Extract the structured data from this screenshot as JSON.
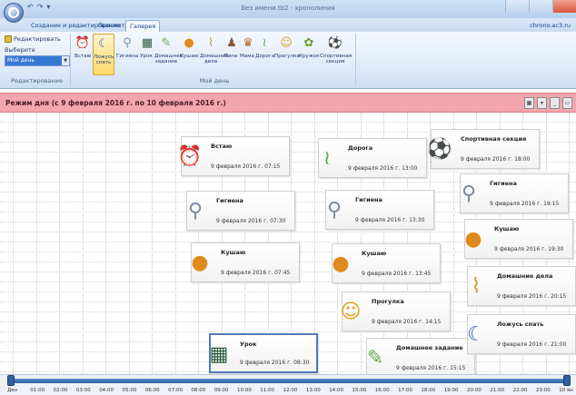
{
  "window": {
    "title": "Без имени.tb2 - хронолиния"
  },
  "tabs": [
    {
      "label": "Создание и редактирование"
    },
    {
      "label": "Просмотр"
    },
    {
      "label": "Галерея"
    }
  ],
  "brand": "chrono.ac3.ru",
  "ribbon": {
    "edit_label": "Редактировать",
    "collection_label": "Выберите коллекцию:",
    "collection_value": "Мой день",
    "edit_group_caption": "Редактирование",
    "day_group_caption": "Мой день",
    "day_items": [
      {
        "label": "Встаю",
        "icon": "alarm-clock-icon"
      },
      {
        "label": "Ложусь спать",
        "icon": "moon-icon"
      },
      {
        "label": "Гигиена",
        "icon": "faucet-icon"
      },
      {
        "label": "Урок",
        "icon": "blackboard-icon"
      },
      {
        "label": "Домашнее задание",
        "icon": "homework-icon"
      },
      {
        "label": "Кушаю",
        "icon": "food-icon"
      },
      {
        "label": "Домашние дела",
        "icon": "broom-icon"
      },
      {
        "label": "Папа",
        "icon": "dad-icon"
      },
      {
        "label": "Мама",
        "icon": "mom-icon"
      },
      {
        "label": "Дорога",
        "icon": "road-icon"
      },
      {
        "label": "Прогулка",
        "icon": "walk-icon"
      },
      {
        "label": "Кружок",
        "icon": "club-icon"
      },
      {
        "label": "Спортивная секция",
        "icon": "ball-icon"
      }
    ]
  },
  "schedule": {
    "title": "Режим дня  (с 9 февраля 2016 г. по 10 февраля 2016 г.)"
  },
  "events": [
    {
      "title": "Встаю",
      "date": "9 февраля 2016 г. 07:15",
      "icon": "alarm-clock-icon"
    },
    {
      "title": "Гигиена",
      "date": "9 февраля 2016 г. 07:30",
      "icon": "faucet-icon"
    },
    {
      "title": "Кушаю",
      "date": "9 февраля 2016 г. 07:45",
      "icon": "food-icon"
    },
    {
      "title": "Урок",
      "date": "9 февраля 2016 г. 08:30",
      "icon": "blackboard-icon"
    },
    {
      "title": "Дорога",
      "date": "9 февраля 2016 г. 13:00",
      "icon": "road-icon"
    },
    {
      "title": "Гигиена",
      "date": "9 февраля 2016 г. 13:30",
      "icon": "faucet-icon"
    },
    {
      "title": "Кушаю",
      "date": "9 февраля 2016 г. 13:45",
      "icon": "food-icon"
    },
    {
      "title": "Прогулка",
      "date": "9 февраля 2016 г. 14:15",
      "icon": "walk-icon"
    },
    {
      "title": "Домашнее задание",
      "date": "9 февраля 2016 г. 15:15",
      "icon": "homework-icon"
    },
    {
      "title": "Спортивная секция",
      "date": "9 февраля 2016 г. 18:00",
      "icon": "ball-icon"
    },
    {
      "title": "Гигиена",
      "date": "9 февраля 2016 г. 19:15",
      "icon": "faucet-icon"
    },
    {
      "title": "Кушаю",
      "date": "9 февраля 2016 г. 19:30",
      "icon": "food-icon"
    },
    {
      "title": "Домашние дела",
      "date": "9 февраля 2016 г. 20:15",
      "icon": "broom-icon"
    },
    {
      "title": "Ложусь спать",
      "date": "9 февраля 2016 г. 21:00",
      "icon": "moon-icon"
    }
  ],
  "timeline": {
    "ticks": [
      "Ден",
      "01:00",
      "02:00",
      "03:00",
      "04:00",
      "05:00",
      "06:00",
      "07:00",
      "08:00",
      "09:00",
      "10:00",
      "11:00",
      "12:00",
      "13:00",
      "14:00",
      "15:00",
      "16:00",
      "17:00",
      "18:00",
      "19:00",
      "20:00",
      "21:00",
      "22:00",
      "23:00",
      "10 ян"
    ]
  },
  "colors": {
    "header_bg": "#f3a6ad",
    "accent": "#2e5f9f",
    "ribbon_selected": "#ffd86b"
  }
}
